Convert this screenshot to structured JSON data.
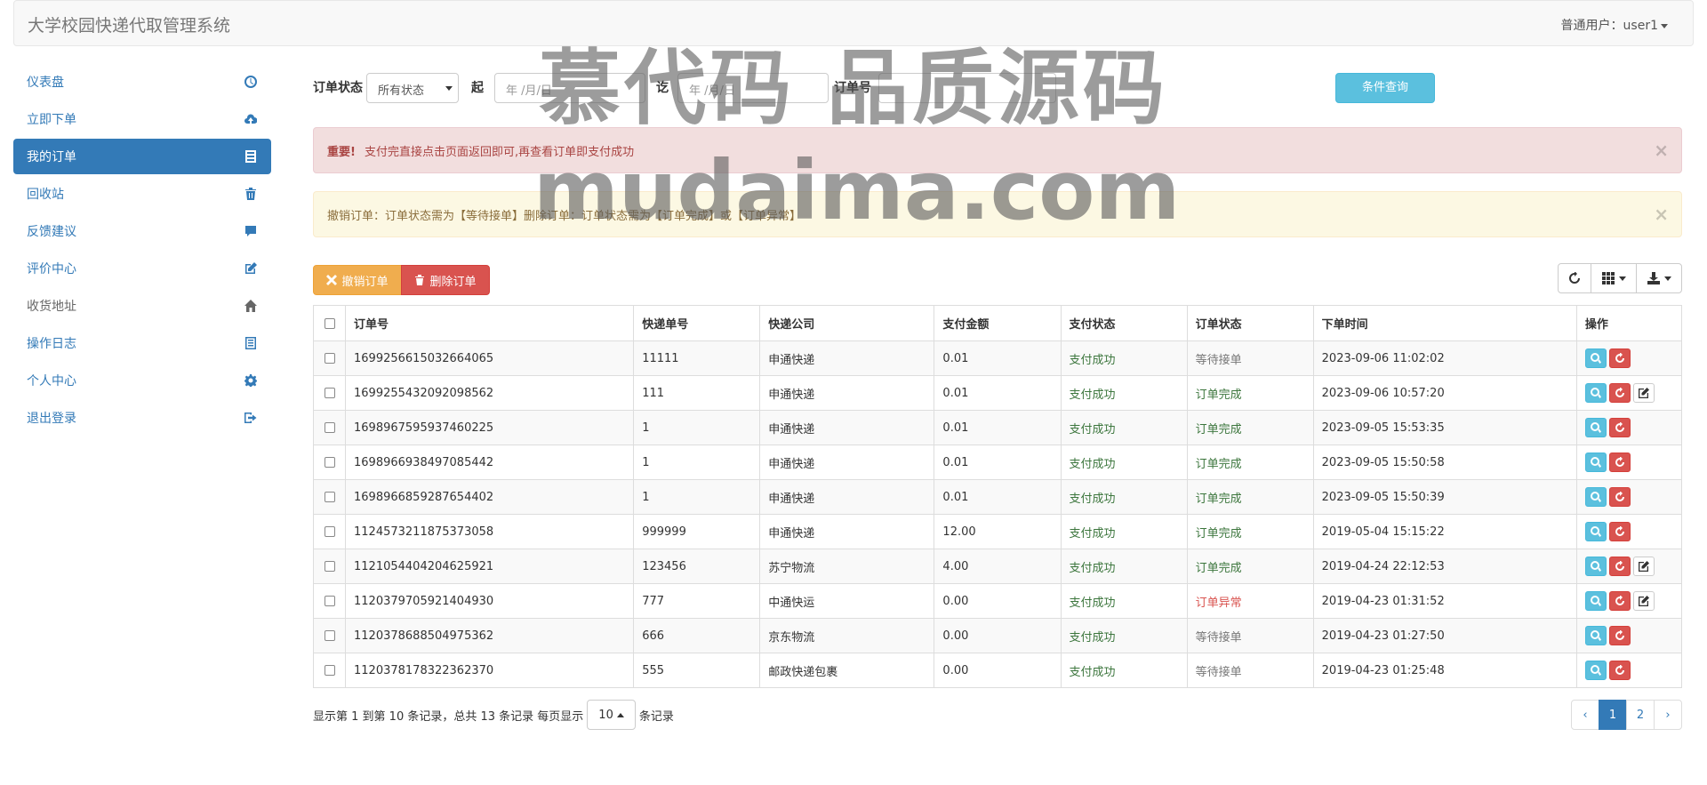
{
  "navbar": {
    "brand": "大学校园快递代取管理系统",
    "user": "普通用户：user1"
  },
  "sidebar": {
    "items": [
      {
        "label": "仪表盘",
        "icon": "dashboard-icon"
      },
      {
        "label": "立即下单",
        "icon": "cloud-upload-icon"
      },
      {
        "label": "我的订单",
        "icon": "list-icon"
      },
      {
        "label": "回收站",
        "icon": "trash-icon"
      },
      {
        "label": "反馈建议",
        "icon": "comment-icon"
      },
      {
        "label": "评价中心",
        "icon": "edit-icon"
      },
      {
        "label": "收货地址",
        "icon": "home-icon"
      },
      {
        "label": "操作日志",
        "icon": "log-icon"
      },
      {
        "label": "个人中心",
        "icon": "gear-icon"
      },
      {
        "label": "退出登录",
        "icon": "logout-icon"
      }
    ],
    "active_index": 2
  },
  "filter": {
    "status_label": "订单状态",
    "status_value": "所有状态",
    "start_label": "起",
    "start_placeholder": "年 /月/日",
    "end_label": "讫",
    "end_placeholder": "年 /月/日",
    "order_no_label": "订单号",
    "search_button": "条件查询"
  },
  "alerts": {
    "danger_title": "重要!",
    "danger_text": "支付完直接点击页面返回即可,再查看订单即支付成功",
    "warning_text": "撤销订单：订单状态需为【等待接单】删除订单：订单状态需为【订单完成】或【订单异常】",
    "close": "×"
  },
  "toolbar": {
    "revoke": "撤销订单",
    "delete": "删除订单"
  },
  "table": {
    "headers": [
      "订单号",
      "快递单号",
      "快递公司",
      "支付金额",
      "支付状态",
      "订单状态",
      "下单时间",
      "操作"
    ],
    "rows": [
      {
        "order_no": "1699256615032664065",
        "tracking": "11111",
        "company": "申通快递",
        "amount": "0.01",
        "pay": "支付成功",
        "status": "等待接单",
        "status_type": "wait",
        "time": "2023-09-06 11:02:02",
        "edit": false
      },
      {
        "order_no": "1699255432092098562",
        "tracking": "111",
        "company": "申通快递",
        "amount": "0.01",
        "pay": "支付成功",
        "status": "订单完成",
        "status_type": "done",
        "time": "2023-09-06 10:57:20",
        "edit": true
      },
      {
        "order_no": "1698967595937460225",
        "tracking": "1",
        "company": "申通快递",
        "amount": "0.01",
        "pay": "支付成功",
        "status": "订单完成",
        "status_type": "done",
        "time": "2023-09-05 15:53:35",
        "edit": false
      },
      {
        "order_no": "1698966938497085442",
        "tracking": "1",
        "company": "申通快递",
        "amount": "0.01",
        "pay": "支付成功",
        "status": "订单完成",
        "status_type": "done",
        "time": "2023-09-05 15:50:58",
        "edit": false
      },
      {
        "order_no": "1698966859287654402",
        "tracking": "1",
        "company": "申通快递",
        "amount": "0.01",
        "pay": "支付成功",
        "status": "订单完成",
        "status_type": "done",
        "time": "2023-09-05 15:50:39",
        "edit": false
      },
      {
        "order_no": "1124573211875373058",
        "tracking": "999999",
        "company": "申通快递",
        "amount": "12.00",
        "pay": "支付成功",
        "status": "订单完成",
        "status_type": "done",
        "time": "2019-05-04 15:15:22",
        "edit": false
      },
      {
        "order_no": "1121054404204625921",
        "tracking": "123456",
        "company": "苏宁物流",
        "amount": "4.00",
        "pay": "支付成功",
        "status": "订单完成",
        "status_type": "done",
        "time": "2019-04-24 22:12:53",
        "edit": true
      },
      {
        "order_no": "1120379705921404930",
        "tracking": "777",
        "company": "中通快运",
        "amount": "0.00",
        "pay": "支付成功",
        "status": "订单异常",
        "status_type": "err",
        "time": "2019-04-23 01:31:52",
        "edit": true
      },
      {
        "order_no": "1120378688504975362",
        "tracking": "666",
        "company": "京东物流",
        "amount": "0.00",
        "pay": "支付成功",
        "status": "等待接单",
        "status_type": "wait",
        "time": "2019-04-23 01:27:50",
        "edit": false
      },
      {
        "order_no": "1120378178322362370",
        "tracking": "555",
        "company": "邮政快递包裹",
        "amount": "0.00",
        "pay": "支付成功",
        "status": "等待接单",
        "status_type": "wait",
        "time": "2019-04-23 01:25:48",
        "edit": false
      }
    ]
  },
  "pagination": {
    "info_prefix": "显示第 1 到第 10 条记录，总共 13 条记录 每页显示",
    "page_size": "10",
    "info_suffix": "条记录",
    "prev": "‹",
    "pages": [
      "1",
      "2"
    ],
    "active_page": "1",
    "next": "›"
  },
  "watermark": {
    "line1": "慕代码 品质源码",
    "line2": "mudaima.com"
  },
  "colors": {
    "primary": "#337ab7",
    "info": "#5bc0de",
    "warning": "#f0ad4e",
    "danger": "#d9534f",
    "success_text": "#3c763d"
  }
}
